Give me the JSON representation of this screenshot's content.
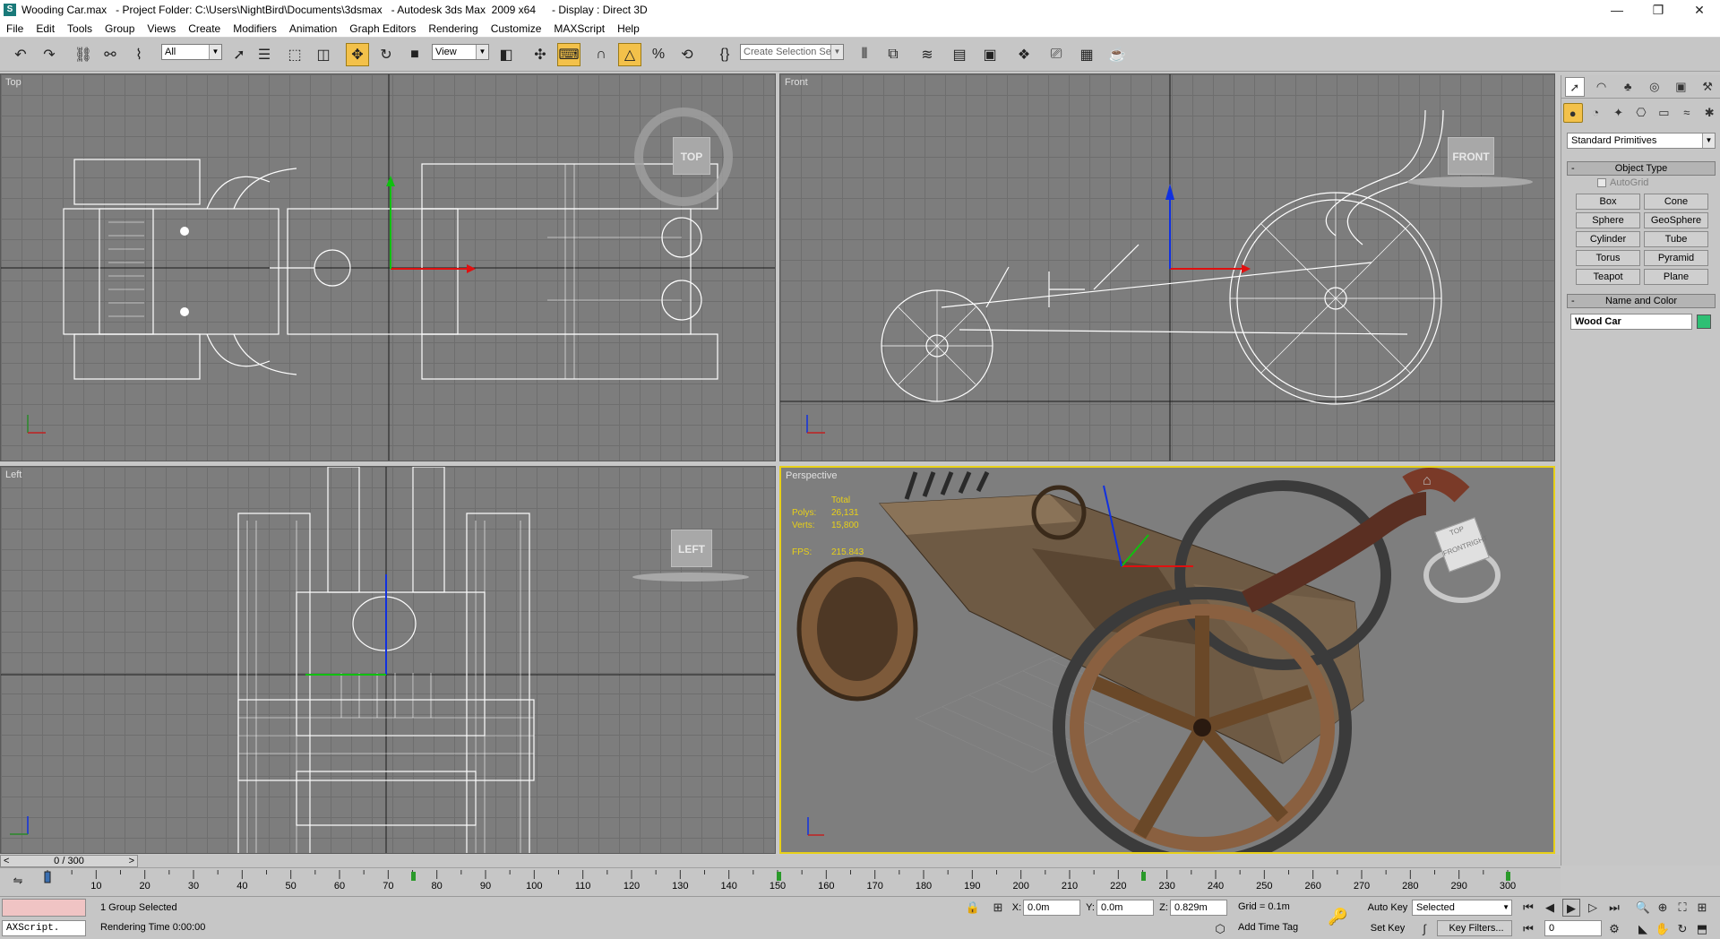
{
  "titlebar": {
    "file": "Wooding Car.max",
    "project": "- Project Folder: C:\\Users\\NightBird\\Documents\\3dsmax",
    "app": "- Autodesk 3ds Max  2009 x64",
    "display": "- Display : Direct 3D",
    "minimize": "—",
    "restore": "❐",
    "close": "✕"
  },
  "menu": [
    "File",
    "Edit",
    "Tools",
    "Group",
    "Views",
    "Create",
    "Modifiers",
    "Animation",
    "Graph Editors",
    "Rendering",
    "Customize",
    "MAXScript",
    "Help"
  ],
  "toolbar": {
    "selection_filter": "All",
    "ref_coord": "View",
    "named_selection_placeholder": "Create Selection Set"
  },
  "viewports": {
    "top": {
      "label": "Top",
      "cube": "TOP"
    },
    "front": {
      "label": "Front",
      "cube": "FRONT"
    },
    "left": {
      "label": "Left",
      "cube": "LEFT"
    },
    "perspective": {
      "label": "Perspective",
      "stats_total": "Total",
      "polys_label": "Polys:",
      "polys_value": "26,131",
      "verts_label": "Verts:",
      "verts_value": "15,800",
      "fps_label": "FPS:",
      "fps_value": "215.843",
      "cube_top": "TOP",
      "cube_front": "FRONT",
      "cube_right": "RIGHT"
    }
  },
  "command_panel": {
    "category": "Standard Primitives",
    "object_type_title": "Object Type",
    "autogrid_label": "AutoGrid",
    "primitives": [
      "Box",
      "Cone",
      "Sphere",
      "GeoSphere",
      "Cylinder",
      "Tube",
      "Torus",
      "Pyramid",
      "Teapot",
      "Plane"
    ],
    "name_color_title": "Name and Color",
    "object_name": "Wood Car",
    "object_color": "#2ebf74"
  },
  "timeline": {
    "frame_display": "0 / 300",
    "current_frame": 0,
    "total_frames": 300,
    "ticks": [
      "10",
      "20",
      "30",
      "40",
      "50",
      "60",
      "70",
      "80",
      "90",
      "100",
      "110",
      "120",
      "130",
      "140",
      "150",
      "160",
      "170",
      "180",
      "190",
      "200",
      "210",
      "220",
      "230",
      "240",
      "250",
      "260",
      "270",
      "280",
      "290",
      "300"
    ]
  },
  "status": {
    "maxscript": "AXScript.",
    "selection": "1 Group Selected",
    "rendering_time": "Rendering Time  0:00:00",
    "x_label": "X:",
    "x_value": "0.0m",
    "y_label": "Y:",
    "y_value": "0.0m",
    "z_label": "Z:",
    "z_value": "0.829m",
    "grid": "Grid = 0.1m",
    "add_time_tag": "Add Time Tag",
    "auto_key": "Auto Key",
    "set_key": "Set Key",
    "key_mode": "Selected",
    "key_filters": "Key Filters...",
    "frame_field": "0"
  }
}
